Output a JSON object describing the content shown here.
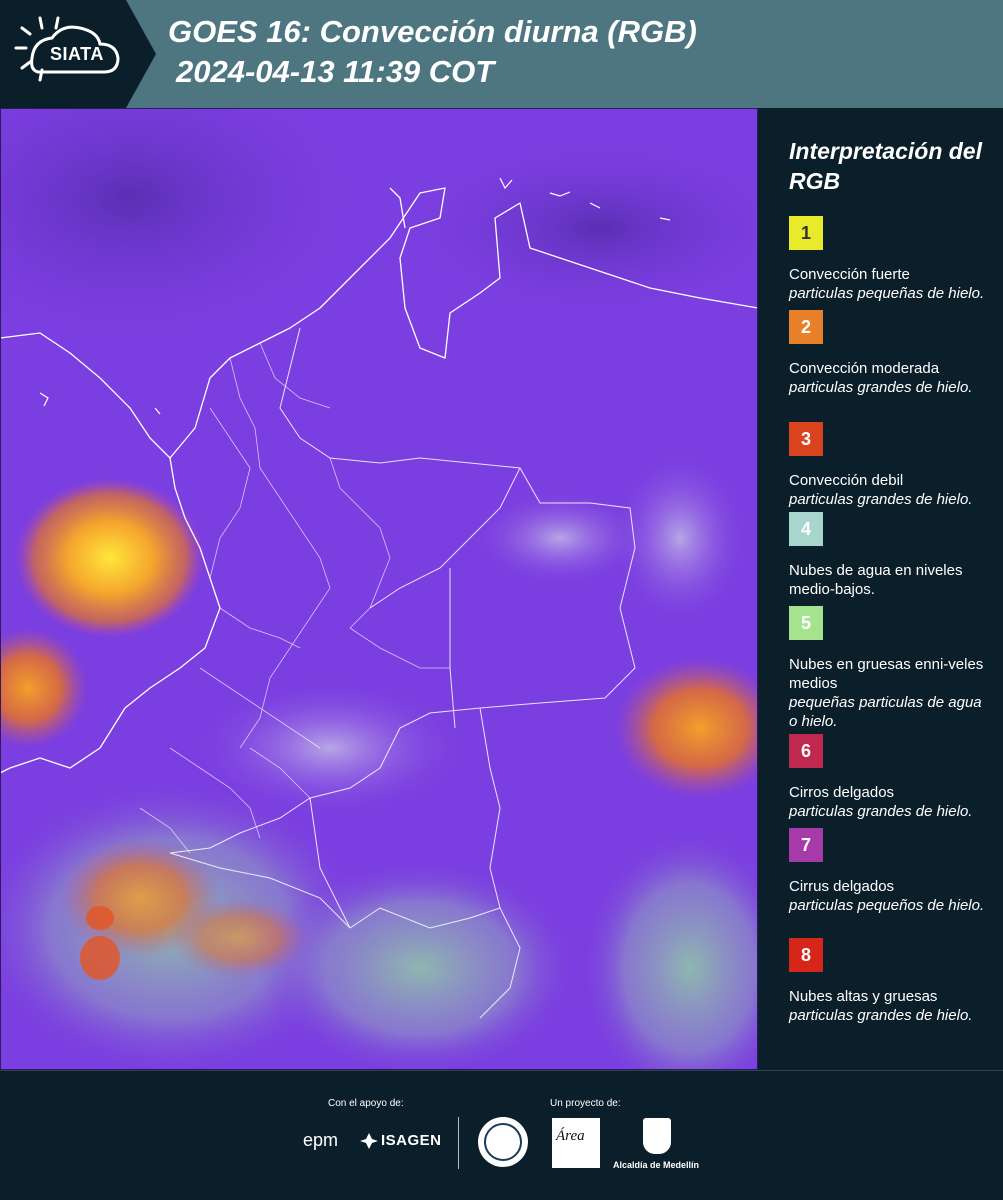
{
  "header": {
    "logo_text": "SIATA",
    "title_line1": "GOES 16: Convección diurna (RGB)",
    "title_line2": "2024-04-13 11:39 COT",
    "bg_color": "#4d7681",
    "tab_color": "#0b1f2b"
  },
  "legend": {
    "title": "Interpretación del RGB",
    "items": [
      {
        "number": "1",
        "color": "#e8ea2a",
        "text_color": "#333333",
        "label": "Convección fuerte",
        "sub": "particulas pequeñas de hielo."
      },
      {
        "number": "2",
        "color": "#e8802a",
        "text_color": "#ffffff",
        "label": "Convección moderada",
        "sub": "particulas grandes de hielo."
      },
      {
        "number": "3",
        "color": "#d9441e",
        "text_color": "#ffffff",
        "label": "Convección debil",
        "sub": "particulas grandes de hielo."
      },
      {
        "number": "4",
        "color": "#a9d6cc",
        "text_color": "#ffffff",
        "label": "Nubes de agua en niveles medio-bajos.",
        "sub": ""
      },
      {
        "number": "5",
        "color": "#a6e38f",
        "text_color": "#ffffff",
        "label": "Nubes en gruesas enni-veles medios",
        "sub": "pequeñas particulas de agua o hielo."
      },
      {
        "number": "6",
        "color": "#c0294f",
        "text_color": "#ffffff",
        "label": "Cirros delgados",
        "sub": "particulas grandes de hielo."
      },
      {
        "number": "7",
        "color": "#a53aa8",
        "text_color": "#ffffff",
        "label": "Cirrus delgados",
        "sub": "particulas pequeños de hielo."
      },
      {
        "number": "8",
        "color": "#d6261a",
        "text_color": "#ffffff",
        "label": "Nubes altas y gruesas",
        "sub": "particulas grandes de hielo."
      }
    ]
  },
  "map": {
    "base_color": "#7a3de0",
    "boundary_color": "#ffffff"
  },
  "footer": {
    "support_label": "Con el apoyo de:",
    "project_label": "Un proyecto de:",
    "sponsor_1": "epm",
    "sponsor_2": "ISAGEN",
    "partner_area": "Área",
    "partner_alcaldia": "Alcaldía de Medellín"
  }
}
